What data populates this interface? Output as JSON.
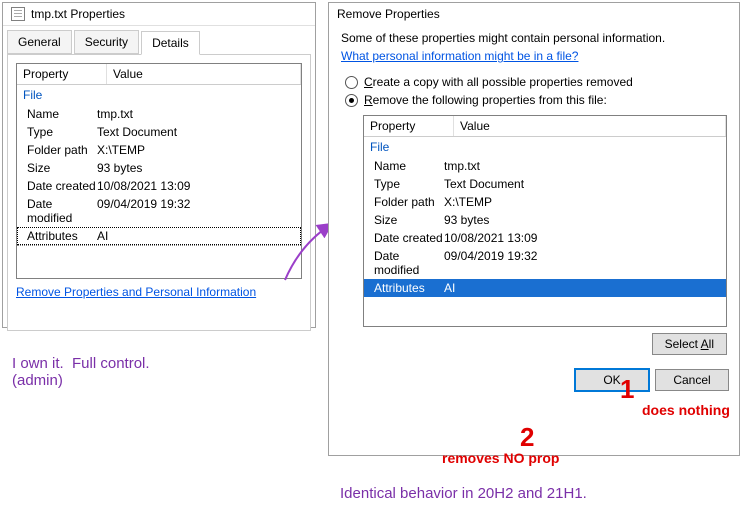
{
  "left_window": {
    "title": "tmp.txt Properties",
    "tabs": [
      "General",
      "Security",
      "Details"
    ],
    "active_tab": "Details",
    "header_prop": "Property",
    "header_val": "Value",
    "group": "File",
    "rows": [
      {
        "k": "Name",
        "v": "tmp.txt"
      },
      {
        "k": "Type",
        "v": "Text Document"
      },
      {
        "k": "Folder path",
        "v": "X:\\TEMP"
      },
      {
        "k": "Size",
        "v": "93 bytes"
      },
      {
        "k": "Date created",
        "v": "10/08/2021 13:09"
      },
      {
        "k": "Date modified",
        "v": "09/04/2019 19:32"
      },
      {
        "k": "Attributes",
        "v": "AI"
      }
    ],
    "remove_link": "Remove Properties and Personal Information"
  },
  "right_window": {
    "title": "Remove Properties",
    "desc": "Some of these properties might contain personal information.",
    "link": "What personal information might be in a file?",
    "radio1": "Create a copy with all possible properties removed",
    "radio2": "Remove the following properties from this file:",
    "header_prop": "Property",
    "header_val": "Value",
    "group": "File",
    "rows": [
      {
        "k": "Name",
        "v": "tmp.txt"
      },
      {
        "k": "Type",
        "v": "Text Document"
      },
      {
        "k": "Folder path",
        "v": "X:\\TEMP"
      },
      {
        "k": "Size",
        "v": "93 bytes"
      },
      {
        "k": "Date created",
        "v": "10/08/2021 13:09"
      },
      {
        "k": "Date modified",
        "v": "09/04/2019 19:32"
      },
      {
        "k": "Attributes",
        "v": "AI"
      }
    ],
    "select_all": "Select All",
    "ok": "OK",
    "cancel": "Cancel"
  },
  "annotations": {
    "own": "I own it.  Full control.\n(admin)",
    "identical": "Identical behavior in 20H2 and 21H1.",
    "num1": "1",
    "does_nothing": "does nothing",
    "num2": "2",
    "removes_no": "removes NO prop"
  }
}
